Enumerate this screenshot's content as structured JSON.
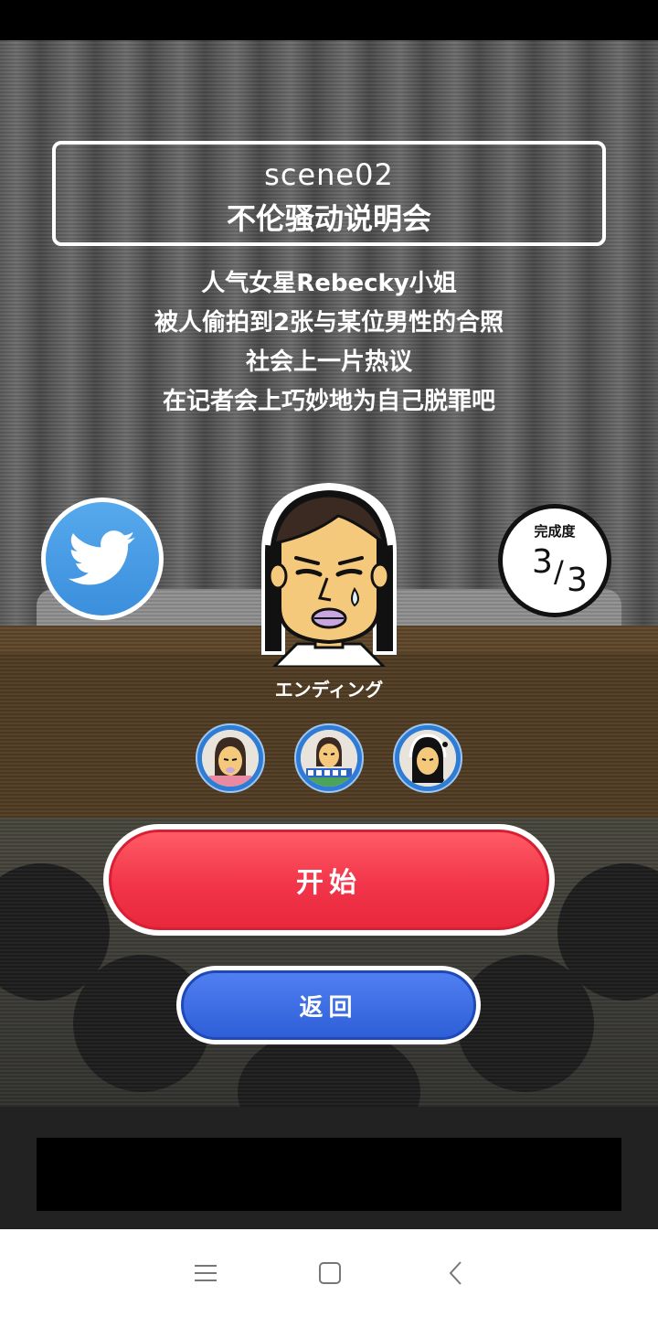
{
  "scene": {
    "title": "scene02",
    "subtitle": "不伦骚动说明会",
    "description": [
      "人气女星Rebecky小姐",
      "被人偷拍到2张与某位男性的合照",
      "社会上一片热议",
      "在记者会上巧妙地为自己脱罪吧"
    ]
  },
  "progress": {
    "label": "完成度",
    "current": "3",
    "total": "3"
  },
  "character": {
    "name": "エンディング"
  },
  "endings_unlocked": 3,
  "buttons": {
    "start": "开始",
    "back": "返回"
  },
  "icons": {
    "share": "twitter-icon",
    "nav_menu": "menu-icon",
    "nav_home": "home-icon",
    "nav_back": "back-icon"
  },
  "colors": {
    "start_button": "#f2354a",
    "back_button": "#2f5fd8",
    "twitter": "#4a9de6"
  }
}
